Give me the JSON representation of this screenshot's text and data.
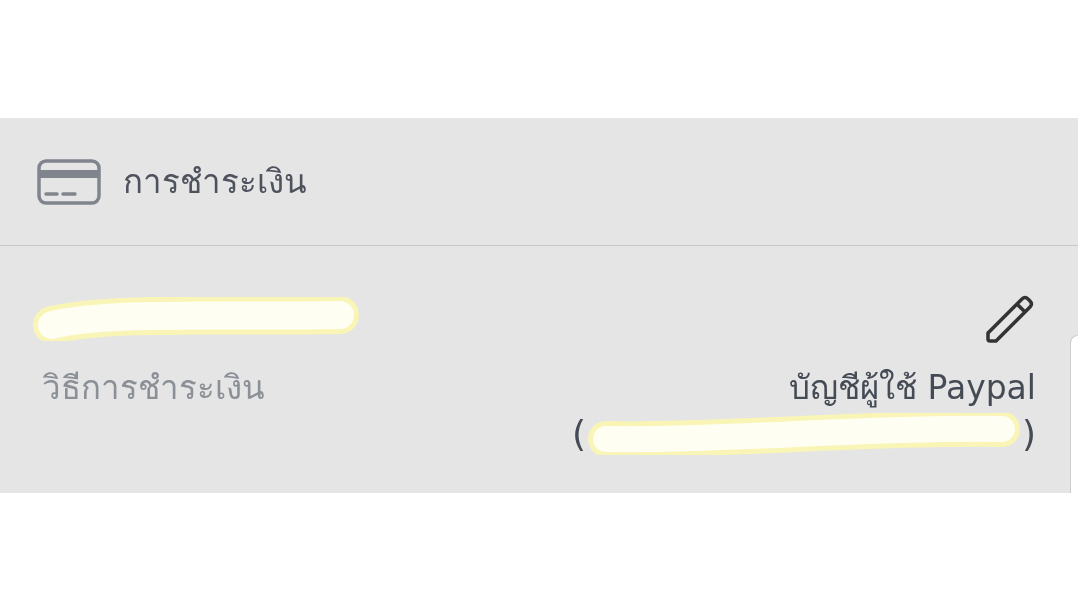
{
  "section": {
    "title": "การชำระเงิน"
  },
  "line_1": {
    "redacted": true
  },
  "payment_method": {
    "label": "วิธีการชำระเงิน",
    "value": "บัญชีผู้ใช้ Paypal",
    "account": {
      "opening": "(",
      "closing": ")",
      "redacted": true
    }
  }
}
